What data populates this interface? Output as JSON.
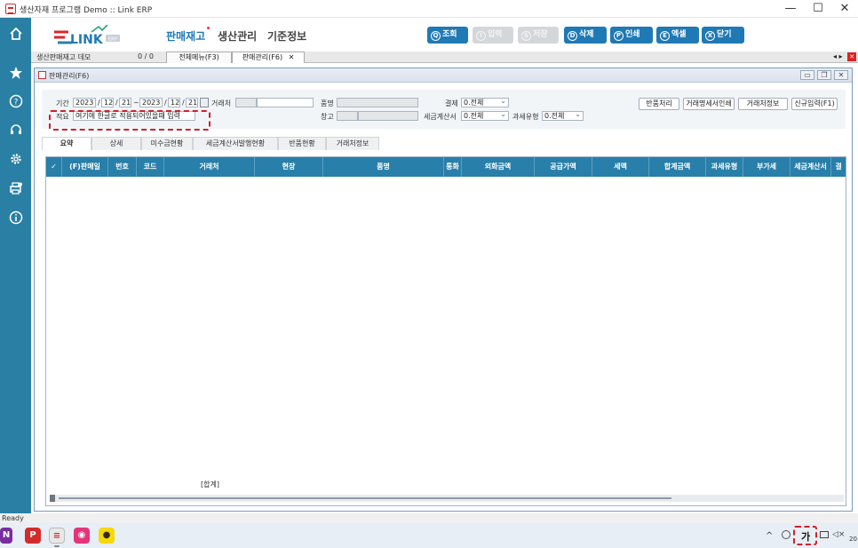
{
  "window": {
    "title": "생산자재 프로그램 Demo :: Link ERP",
    "minimize": "—",
    "maximize": "☐",
    "close": "✕"
  },
  "brand": {
    "logo": "LINK",
    "logo_badge": "ERP"
  },
  "menu": [
    "판매재고",
    "생산관리",
    "기준정보"
  ],
  "toolbar": [
    {
      "key": "Q",
      "label": "조회",
      "enabled": true
    },
    {
      "key": "I",
      "label": "입력",
      "enabled": false
    },
    {
      "key": "S",
      "label": "저장",
      "enabled": false
    },
    {
      "key": "D",
      "label": "삭제",
      "enabled": true
    },
    {
      "key": "P",
      "label": "인쇄",
      "enabled": true
    },
    {
      "key": "E",
      "label": "엑셀",
      "enabled": true
    },
    {
      "key": "X",
      "label": "닫기",
      "enabled": true
    }
  ],
  "tabstrip": {
    "doc_name": "생산판매재고 데모",
    "pager": "0 / 0",
    "tabs": [
      "전체메뉴(F3)",
      "판매관리(F6)"
    ],
    "close": "✕",
    "nav": "◂ ▸",
    "close_all": "✕"
  },
  "inner": {
    "title": "판매관리(F6)",
    "btn_min": "▭",
    "btn_restore": "❐",
    "btn_close": "✕"
  },
  "filter": {
    "period_label": "기간",
    "from_year": "2023",
    "from_month": "12",
    "from_day": "21",
    "sep": "~",
    "to_year": "2023",
    "to_month": "12",
    "to_day": "21",
    "slash": "/",
    "customer_label": "거래처",
    "item_label": "품명",
    "payment_label": "결제",
    "payment_value": "0.전체",
    "memo_label": "적요",
    "memo_value": "여기에 한글로 적용되어있을때 입력",
    "warehouse_label": "창고",
    "tax_invoice_label": "세금계산서",
    "tax_invoice_value": "0.전체",
    "tax_type_label": "과세유형",
    "tax_type_value": "0.전체"
  },
  "actions": [
    "반품처리",
    "거래명세서인쇄",
    "거래처정보",
    "신규입력(F1)"
  ],
  "subtabs": [
    "요약",
    "상세",
    "미수금현황",
    "세금계산서발행현황",
    "반품현황",
    "거래처정보"
  ],
  "grid": {
    "check": "✓",
    "columns": [
      "(F)판매일",
      "번호",
      "코드",
      "거래처",
      "현장",
      "품명",
      "통화",
      "외화금액",
      "공급가액",
      "세액",
      "합계금액",
      "과세유형",
      "부가세",
      "세금계산서",
      "결"
    ],
    "total_label": "[합계]"
  },
  "status": "Ready",
  "taskbar": {
    "apps": [
      {
        "name": "onenote",
        "glyph": "N",
        "color": "#7b2c9e"
      },
      {
        "name": "pdf",
        "glyph": "P",
        "color": "#d42a2a"
      },
      {
        "name": "link-erp",
        "glyph": "≡",
        "color": "#e8e8e8"
      },
      {
        "name": "tray-app",
        "glyph": "◉",
        "color": "#e2357a"
      },
      {
        "name": "kakaotalk",
        "glyph": "●",
        "color": "#f5d90a"
      }
    ],
    "tray_up": "^",
    "ime": "가",
    "clock": "20"
  },
  "colors": {
    "sidebar": "#2a7fa5",
    "accent": "#1f79b5",
    "grid_header": "#287fa9",
    "highlight": "#d0202a"
  }
}
